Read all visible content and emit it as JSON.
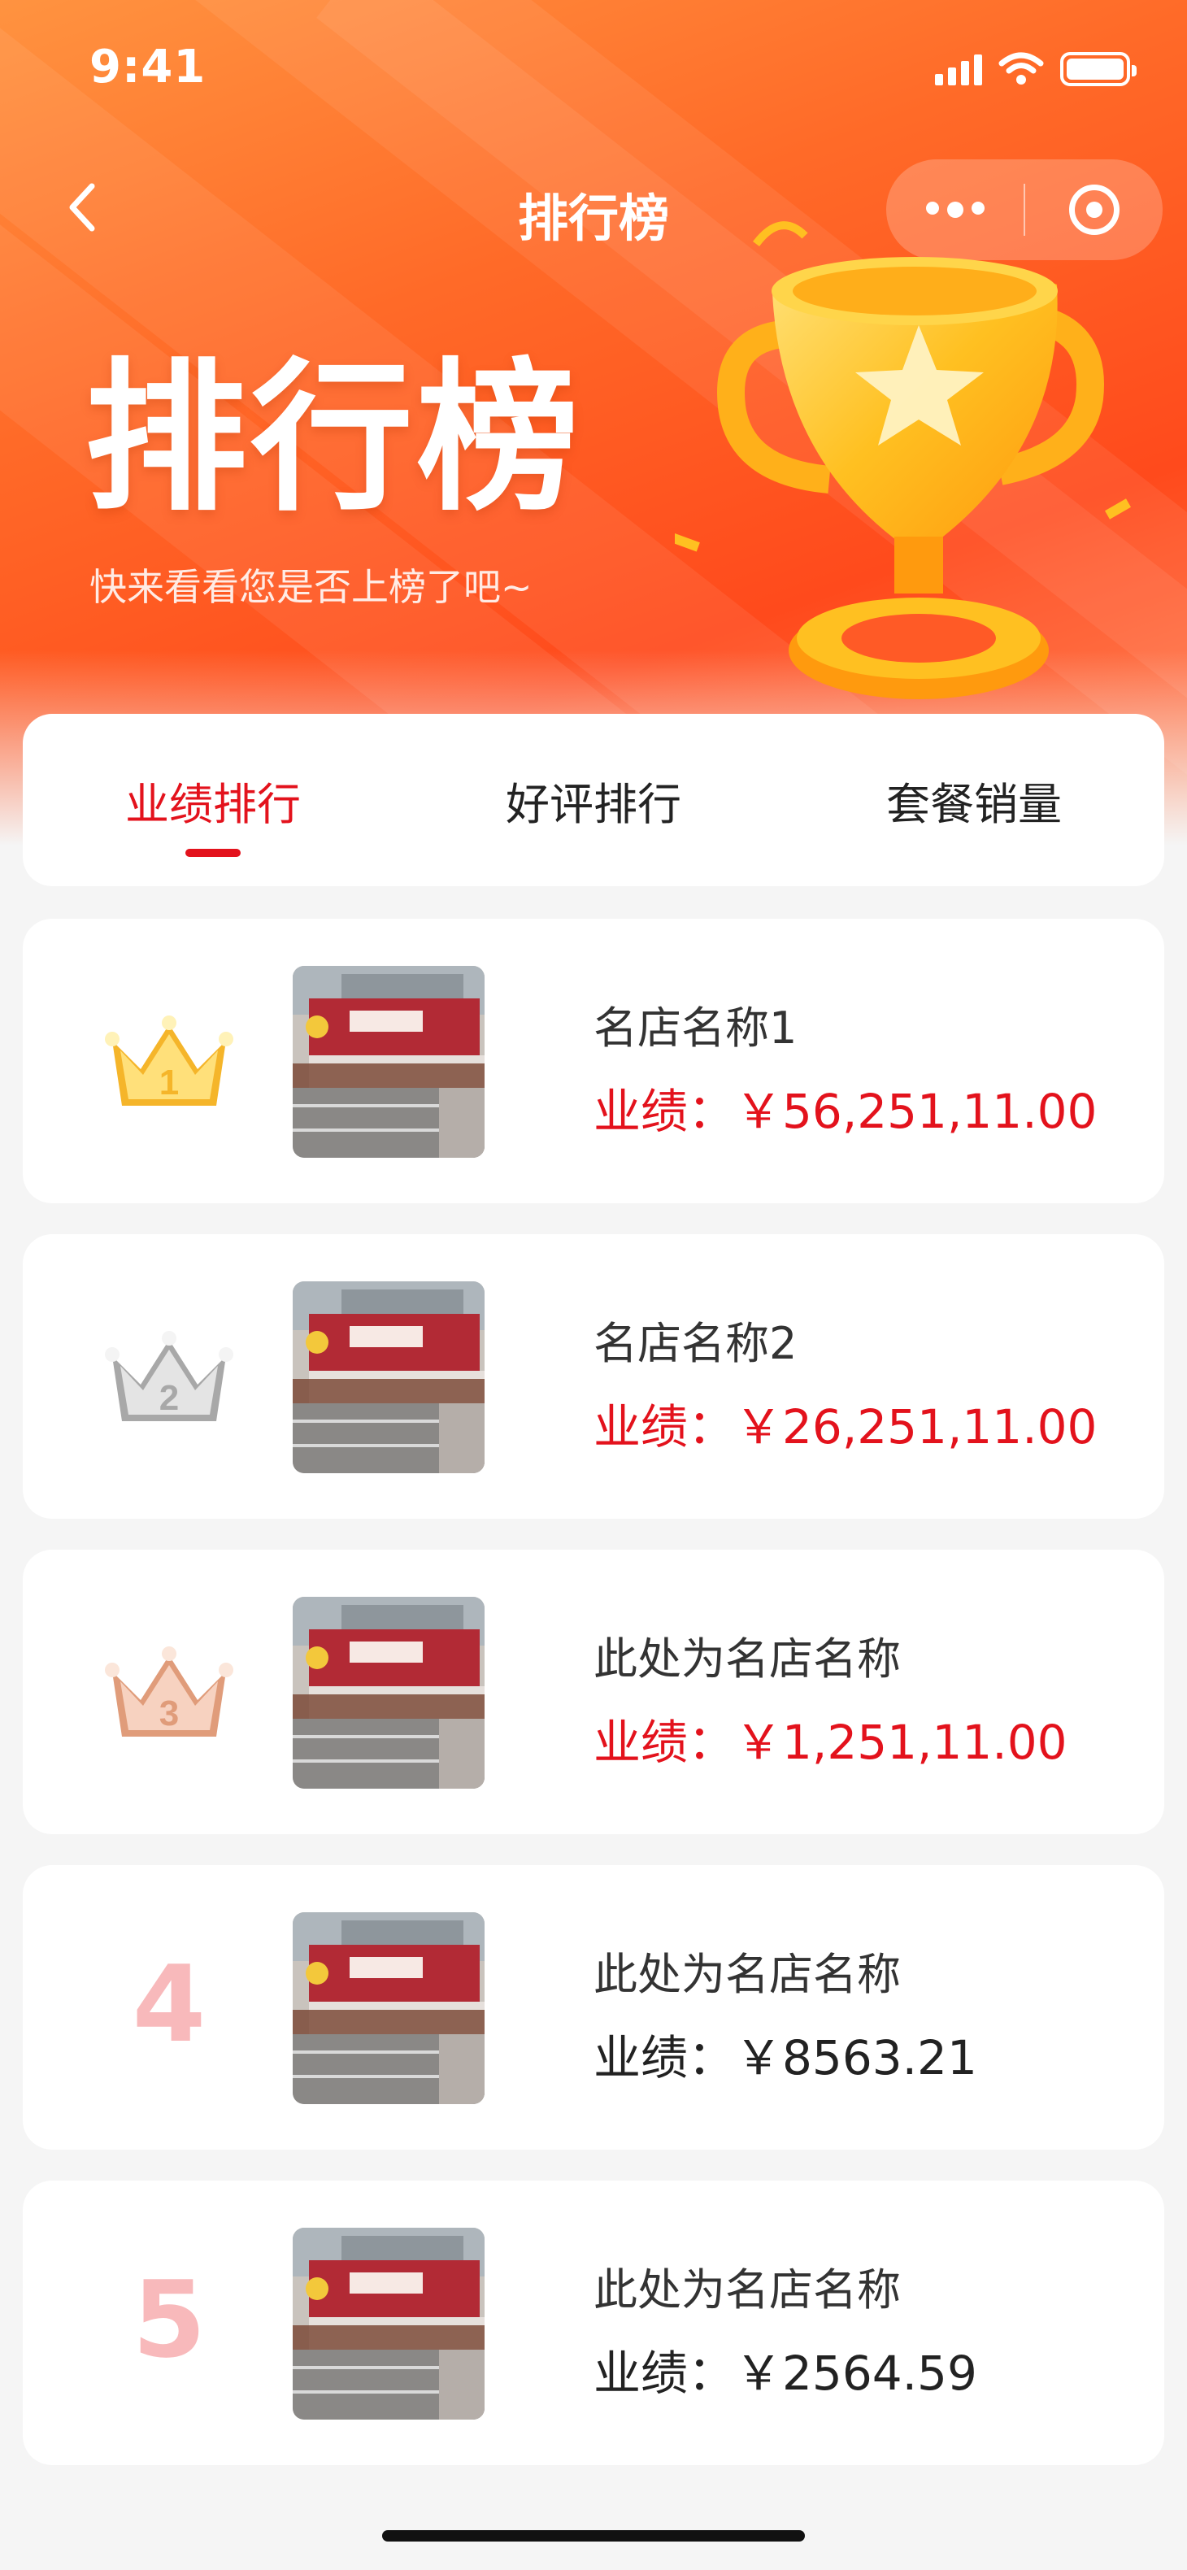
{
  "status_bar": {
    "time": "9:41"
  },
  "nav": {
    "title": "排行榜",
    "back_icon": "chevron-left-icon",
    "more_icon": "more-dots-icon",
    "close_icon": "target-icon"
  },
  "hero": {
    "title": "排行榜",
    "subtitle": "快来看看您是否上榜了吧~",
    "image": "trophy-illustration"
  },
  "tabs": [
    {
      "label": "业绩排行",
      "active": true
    },
    {
      "label": "好评排行",
      "active": false
    },
    {
      "label": "套餐销量",
      "active": false
    }
  ],
  "colors": {
    "accent": "#e3121c",
    "header_orange": "#ff6a28",
    "rank_pink": "#f8b9bb"
  },
  "rankings": [
    {
      "rank": "1",
      "badge": "gold-crown-icon",
      "name": "名店名称1",
      "perf_label": "业绩：",
      "perf_value": "￥56,251,11.00",
      "highlight": true
    },
    {
      "rank": "2",
      "badge": "silver-crown-icon",
      "name": "名店名称2",
      "perf_label": "业绩：",
      "perf_value": "￥26,251,11.00",
      "highlight": true
    },
    {
      "rank": "3",
      "badge": "bronze-crown-icon",
      "name": "此处为名店名称",
      "perf_label": "业绩：",
      "perf_value": "￥1,251,11.00",
      "highlight": true
    },
    {
      "rank": "4",
      "badge": "",
      "name": "此处为名店名称",
      "perf_label": "业绩：",
      "perf_value": "￥8563.21",
      "highlight": false
    },
    {
      "rank": "5",
      "badge": "",
      "name": "此处为名店名称",
      "perf_label": "业绩：",
      "perf_value": "￥2564.59",
      "highlight": false
    }
  ]
}
